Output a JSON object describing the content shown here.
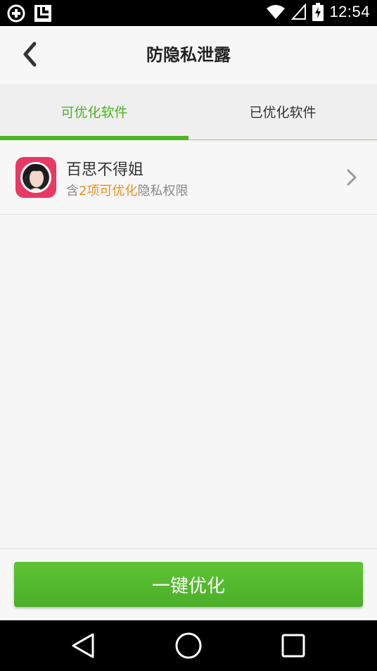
{
  "status_bar": {
    "time": "12:54",
    "icons": [
      "add-circle-icon",
      "app-notification-icon",
      "wifi-icon",
      "no-signal-icon",
      "battery-charging-icon"
    ]
  },
  "header": {
    "title": "防隐私泄露",
    "back_icon": "chevron-left-icon"
  },
  "tabs": [
    {
      "label": "可优化软件",
      "active": true
    },
    {
      "label": "已优化软件",
      "active": false
    }
  ],
  "apps": [
    {
      "name": "百思不得姐",
      "desc_prefix": "含",
      "desc_highlight": "2项可优化",
      "desc_suffix": "隐私权限",
      "icon": "app-avatar-icon"
    }
  ],
  "primary_button": {
    "label": "一键优化"
  },
  "colors": {
    "accent": "#4cb522",
    "highlight": "#f08f1c",
    "button_green": "#54b82d",
    "app_icon_bg": "#e83864"
  },
  "nav_bar": {
    "icons": [
      "back-triangle-icon",
      "home-circle-icon",
      "recents-square-icon"
    ]
  }
}
